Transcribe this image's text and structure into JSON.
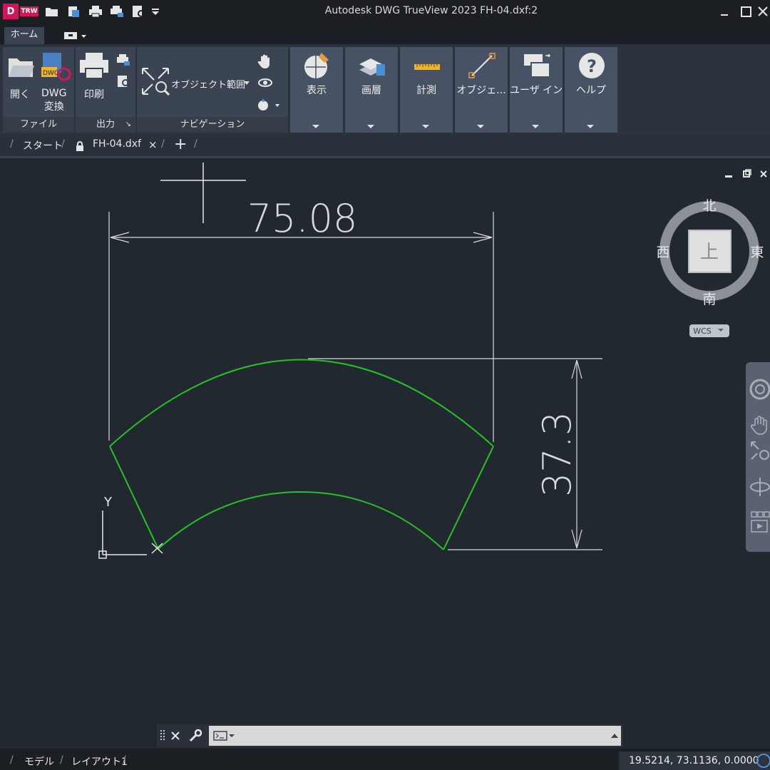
{
  "titlebar": {
    "logo_letter": "D",
    "logo_text": "TRW",
    "title": "Autodesk DWG TrueView 2023    FH-04.dxf:2"
  },
  "ribbon_tabs": {
    "home": "ホーム"
  },
  "ribbon": {
    "file_panel": {
      "title": "ファイル",
      "open": "開く",
      "dwg_convert_1": "DWG",
      "dwg_convert_2": "変換"
    },
    "output_panel": {
      "title": "出力",
      "print": "印刷"
    },
    "nav_panel": {
      "title": "ナビゲーション",
      "extents": "オブジェクト範囲"
    },
    "dropdowns": [
      "表示",
      "画層",
      "計測",
      "オブジェ...",
      "ユーザ イン...",
      "ヘルプ"
    ]
  },
  "doc_tabs": {
    "start": "スタート",
    "file": "FH-04.dxf"
  },
  "drawing": {
    "dim_horizontal": "75.08",
    "dim_vertical": "37.3",
    "ucs_y": "Y",
    "ucs_x": "X"
  },
  "viewcube": {
    "north": "北",
    "south": "南",
    "east": "東",
    "west": "西",
    "top": "上",
    "wcs": "WCS"
  },
  "status": {
    "model_tab": "モデル",
    "layout_tab": "レイアウト1",
    "coords": "19.5214, 73.1136, 0.0000"
  },
  "colors": {
    "geometry": "#22c322",
    "dimension": "#d9d9d9",
    "background": "#212830"
  }
}
